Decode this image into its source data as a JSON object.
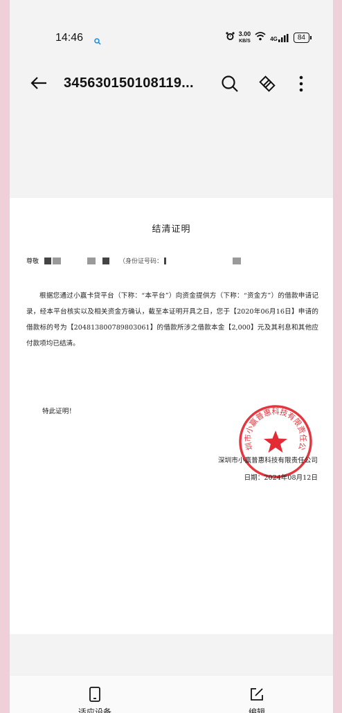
{
  "status": {
    "time": "14:46",
    "speed_value": "3.00",
    "speed_unit": "KB/S",
    "network": "4G",
    "battery": "84"
  },
  "appbar": {
    "title": "345630150108119..."
  },
  "document": {
    "title": "结清证明",
    "salutation": "尊敬",
    "id_label": "（身份证号码：",
    "body": "根据您通过小赢卡贷平台（下称：“本平台”）向资金提供方（下称：“资金方”）的借款申请记录，经本平台核实以及相关资金方确认，截至本证明开具之日，您于【2020年06月16日】申请的借款标的号为【20481380078980​3061】的借款所涉之借款本金【2,000】元及其利息和其他应付款项均已结清。",
    "special": "特此证明！",
    "company": "深圳市小赢普惠科技有限责任公司",
    "date": "日期：2024年08月12日",
    "seal_text": "深圳市小赢普惠科技有限责任公司"
  },
  "bottombar": {
    "device_label": "适应设备",
    "edit_label": "编辑"
  },
  "colors": {
    "background": "#efd0d8",
    "seal": "#e0202a"
  }
}
